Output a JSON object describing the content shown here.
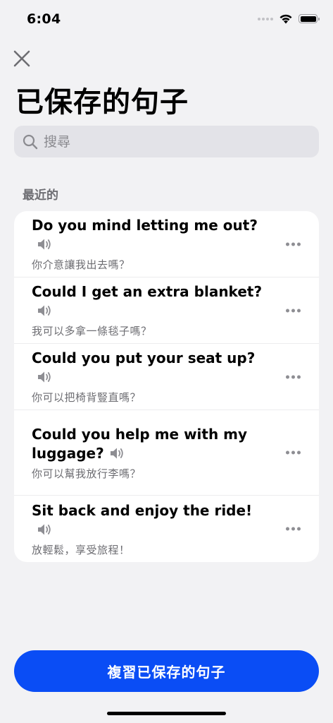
{
  "status": {
    "time": "6:04"
  },
  "header": {
    "title": "已保存的句子"
  },
  "search": {
    "placeholder": "搜尋"
  },
  "section": {
    "title": "最近的"
  },
  "sentences": [
    {
      "text": "Do you mind letting me out?",
      "translation": "你介意讓我出去嗎？"
    },
    {
      "text": "Could I get an extra blanket?",
      "translation": "我可以多拿一條毯子嗎？"
    },
    {
      "text": "Could you put your seat up?",
      "translation": "你可以把椅背豎直嗎？"
    },
    {
      "text": "Could you help me with my luggage?",
      "translation": "你可以幫我放行李嗎？"
    },
    {
      "text": "Sit back and enjoy the ride!",
      "translation": "放輕鬆，享受旅程！"
    }
  ],
  "footer": {
    "review_label": "複習已保存的句子"
  },
  "colors": {
    "accent": "#0a4df5",
    "background": "#f2f2f4",
    "secondary_text": "#6d6d72"
  },
  "icons": [
    "close-icon",
    "search-icon",
    "speaker-icon",
    "more-icon",
    "wifi-icon",
    "battery-icon"
  ]
}
